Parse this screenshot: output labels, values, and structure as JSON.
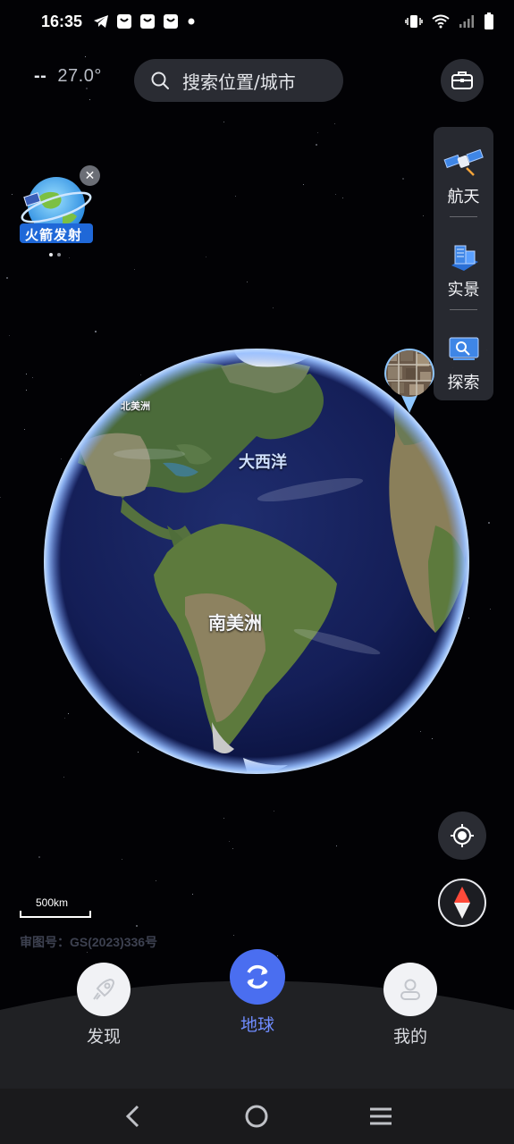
{
  "status_bar": {
    "time": "16:35",
    "left_icons": [
      "telegram-icon",
      "shopping-bag-icon",
      "shopping-bag-icon",
      "shopping-bag-icon",
      "dot-icon"
    ],
    "right_icons": [
      "vibrate-icon",
      "wifi-icon",
      "signal-icon",
      "battery-icon"
    ]
  },
  "weather": {
    "dash": "--",
    "temperature": "27.0°"
  },
  "search": {
    "placeholder": "搜索位置/城市"
  },
  "side_panel": {
    "items": [
      {
        "label": "航天",
        "icon": "satellite-icon"
      },
      {
        "label": "实景",
        "icon": "city-blocks-icon"
      },
      {
        "label": "探索",
        "icon": "explore-icon"
      }
    ]
  },
  "promo_badge": {
    "text": "火箭发射",
    "page_count": 2,
    "active_page": 0
  },
  "globe": {
    "labels": {
      "north_america": "北美洲",
      "atlantic": "大西洋",
      "south_america": "南美洲"
    }
  },
  "map": {
    "scale_text": "500km",
    "review_number": "审图号：GS(2023)336号"
  },
  "bottom_nav": {
    "items": [
      {
        "label": "发现",
        "icon": "rocket-icon",
        "active": false
      },
      {
        "label": "地球",
        "icon": "refresh-icon",
        "active": true
      },
      {
        "label": "我的",
        "icon": "user-icon",
        "active": false
      }
    ]
  },
  "colors": {
    "accent": "#4a6ef0",
    "accent_text": "#6f8cff",
    "panel": "#2a2c33"
  }
}
